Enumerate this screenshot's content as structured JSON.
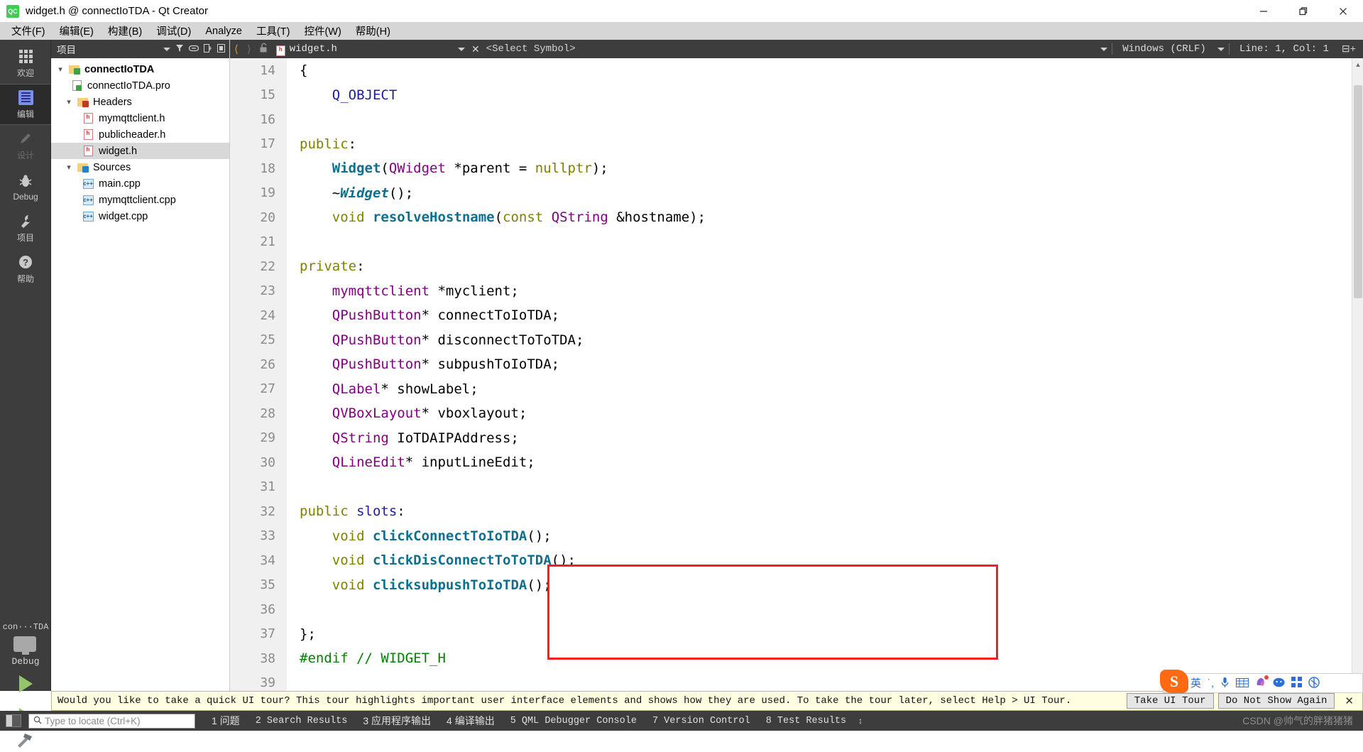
{
  "window": {
    "title": "widget.h @ connectIoTDA - Qt Creator",
    "app_icon": "qt-creator-icon",
    "minimize": "—",
    "restore": "❐",
    "close": "✕"
  },
  "menubar": {
    "items": [
      {
        "label": "文件(F)",
        "name": "menu-file"
      },
      {
        "label": "编辑(E)",
        "name": "menu-edit"
      },
      {
        "label": "构建(B)",
        "name": "menu-build"
      },
      {
        "label": "调试(D)",
        "name": "menu-debug"
      },
      {
        "label": "Analyze",
        "name": "menu-analyze"
      },
      {
        "label": "工具(T)",
        "name": "menu-tools"
      },
      {
        "label": "控件(W)",
        "name": "menu-window"
      },
      {
        "label": "帮助(H)",
        "name": "menu-help"
      }
    ]
  },
  "modebar": {
    "items": [
      {
        "label": "欢迎",
        "icon": "grid-icon",
        "state": "normal"
      },
      {
        "label": "编辑",
        "icon": "document-icon",
        "state": "active"
      },
      {
        "label": "设计",
        "icon": "pencil-icon",
        "state": "disabled"
      },
      {
        "label": "Debug",
        "icon": "bug-icon",
        "state": "normal"
      },
      {
        "label": "项目",
        "icon": "wrench-icon",
        "state": "normal"
      },
      {
        "label": "帮助",
        "icon": "question-icon",
        "state": "normal"
      }
    ],
    "kit": {
      "project": "con···TDA",
      "build_config": "Debug",
      "run_icon": "run-triangle-icon",
      "debug_icon": "run-debug-icon",
      "build_icon": "hammer-icon"
    }
  },
  "sidebar": {
    "header_title": "项目",
    "tools": [
      "filter-icon",
      "link-icon",
      "split-icon",
      "settings-icon"
    ],
    "tree": [
      {
        "label": "connectIoTDA",
        "icon": "qt-project-folder-icon",
        "indent": 0,
        "twisty": "expanded",
        "bold": true,
        "selected": false
      },
      {
        "label": "connectIoTDA.pro",
        "icon": "qt-pro-file-icon",
        "indent": 1,
        "twisty": "none",
        "bold": false,
        "selected": false
      },
      {
        "label": "Headers",
        "icon": "headers-folder-icon",
        "indent": 1,
        "twisty": "expanded",
        "bold": false,
        "selected": false
      },
      {
        "label": "mymqttclient.h",
        "icon": "h-file-icon",
        "indent": 2,
        "twisty": "none",
        "bold": false,
        "selected": false
      },
      {
        "label": "publicheader.h",
        "icon": "h-file-icon",
        "indent": 2,
        "twisty": "none",
        "bold": false,
        "selected": false
      },
      {
        "label": "widget.h",
        "icon": "h-file-icon",
        "indent": 2,
        "twisty": "none",
        "bold": false,
        "selected": true
      },
      {
        "label": "Sources",
        "icon": "sources-folder-icon",
        "indent": 1,
        "twisty": "expanded",
        "bold": false,
        "selected": false
      },
      {
        "label": "main.cpp",
        "icon": "cpp-file-icon",
        "indent": 2,
        "twisty": "none",
        "bold": false,
        "selected": false
      },
      {
        "label": "mymqttclient.cpp",
        "icon": "cpp-file-icon",
        "indent": 2,
        "twisty": "none",
        "bold": false,
        "selected": false
      },
      {
        "label": "widget.cpp",
        "icon": "cpp-file-icon",
        "indent": 2,
        "twisty": "none",
        "bold": false,
        "selected": false
      }
    ]
  },
  "editor_toolbar": {
    "back_icon": "back-arrow-icon",
    "forward_icon": "forward-arrow-icon",
    "lock_icon": "unlock-icon",
    "file_icon": "h-file-icon",
    "file_name": "widget.h",
    "close_icon": "close-icon",
    "symbol_selector": "<Select Symbol>",
    "line_ending": "Windows (CRLF)",
    "cursor_position": "Line: 1, Col: 1",
    "split_icon": "split-editor-icon"
  },
  "code": {
    "first_line": 14,
    "lines": [
      {
        "num": "14",
        "tokens": [
          {
            "t": "{",
            "c": "punct"
          }
        ],
        "indent": 0
      },
      {
        "num": "15",
        "tokens": [
          {
            "t": "    ",
            "c": "plain"
          },
          {
            "t": "Q_OBJECT",
            "c": "macro"
          }
        ],
        "indent": 0
      },
      {
        "num": "16",
        "tokens": [],
        "indent": 0
      },
      {
        "num": "17",
        "tokens": [
          {
            "t": "public",
            "c": "kw"
          },
          {
            "t": ":",
            "c": "punct"
          }
        ],
        "indent": 0
      },
      {
        "num": "18",
        "tokens": [
          {
            "t": "    ",
            "c": "plain"
          },
          {
            "t": "Widget",
            "c": "fn"
          },
          {
            "t": "(",
            "c": "punct"
          },
          {
            "t": "QWidget",
            "c": "type"
          },
          {
            "t": " *parent = ",
            "c": "punct"
          },
          {
            "t": "nullptr",
            "c": "kw"
          },
          {
            "t": ");",
            "c": "punct"
          }
        ],
        "indent": 0
      },
      {
        "num": "19",
        "tokens": [
          {
            "t": "    ~",
            "c": "punct"
          },
          {
            "t": "Widget",
            "c": "fnd"
          },
          {
            "t": "();",
            "c": "punct"
          }
        ],
        "indent": 0
      },
      {
        "num": "20",
        "tokens": [
          {
            "t": "    ",
            "c": "plain"
          },
          {
            "t": "void",
            "c": "kw"
          },
          {
            "t": " ",
            "c": "plain"
          },
          {
            "t": "resolveHostname",
            "c": "fn"
          },
          {
            "t": "(",
            "c": "punct"
          },
          {
            "t": "const",
            "c": "kw"
          },
          {
            "t": " ",
            "c": "plain"
          },
          {
            "t": "QString",
            "c": "type"
          },
          {
            "t": " &hostname);",
            "c": "punct"
          }
        ],
        "indent": 0
      },
      {
        "num": "21",
        "tokens": [],
        "indent": 0
      },
      {
        "num": "22",
        "tokens": [
          {
            "t": "private",
            "c": "kw"
          },
          {
            "t": ":",
            "c": "punct"
          }
        ],
        "indent": 0
      },
      {
        "num": "23",
        "tokens": [
          {
            "t": "    ",
            "c": "plain"
          },
          {
            "t": "mymqttclient",
            "c": "type"
          },
          {
            "t": " *myclient;",
            "c": "punct"
          }
        ],
        "indent": 0
      },
      {
        "num": "24",
        "tokens": [
          {
            "t": "    ",
            "c": "plain"
          },
          {
            "t": "QPushButton",
            "c": "type"
          },
          {
            "t": "* connectToIoTDA;",
            "c": "punct"
          }
        ],
        "indent": 0
      },
      {
        "num": "25",
        "tokens": [
          {
            "t": "    ",
            "c": "plain"
          },
          {
            "t": "QPushButton",
            "c": "type"
          },
          {
            "t": "* disconnectToToTDA;",
            "c": "punct"
          }
        ],
        "indent": 0
      },
      {
        "num": "26",
        "tokens": [
          {
            "t": "    ",
            "c": "plain"
          },
          {
            "t": "QPushButton",
            "c": "type"
          },
          {
            "t": "* subpushToIoTDA;",
            "c": "punct"
          }
        ],
        "indent": 0
      },
      {
        "num": "27",
        "tokens": [
          {
            "t": "    ",
            "c": "plain"
          },
          {
            "t": "QLabel",
            "c": "type"
          },
          {
            "t": "* showLabel;",
            "c": "punct"
          }
        ],
        "indent": 0
      },
      {
        "num": "28",
        "tokens": [
          {
            "t": "    ",
            "c": "plain"
          },
          {
            "t": "QVBoxLayout",
            "c": "type"
          },
          {
            "t": "* vboxlayout;",
            "c": "punct"
          }
        ],
        "indent": 0
      },
      {
        "num": "29",
        "tokens": [
          {
            "t": "    ",
            "c": "plain"
          },
          {
            "t": "QString",
            "c": "type"
          },
          {
            "t": " IoTDAIPAddress;",
            "c": "punct"
          }
        ],
        "indent": 0
      },
      {
        "num": "30",
        "tokens": [
          {
            "t": "    ",
            "c": "plain"
          },
          {
            "t": "QLineEdit",
            "c": "type"
          },
          {
            "t": "* inputLineEdit;",
            "c": "punct"
          }
        ],
        "indent": 0
      },
      {
        "num": "31",
        "tokens": [],
        "indent": 0
      },
      {
        "num": "32",
        "tokens": [
          {
            "t": "public",
            "c": "kw"
          },
          {
            "t": " ",
            "c": "plain"
          },
          {
            "t": "slots",
            "c": "macro"
          },
          {
            "t": ":",
            "c": "punct"
          }
        ],
        "indent": 0
      },
      {
        "num": "33",
        "tokens": [
          {
            "t": "    ",
            "c": "plain"
          },
          {
            "t": "void",
            "c": "kw"
          },
          {
            "t": " ",
            "c": "plain"
          },
          {
            "t": "clickConnectToIoTDA",
            "c": "fn"
          },
          {
            "t": "();",
            "c": "punct"
          }
        ],
        "indent": 0
      },
      {
        "num": "34",
        "tokens": [
          {
            "t": "    ",
            "c": "plain"
          },
          {
            "t": "void",
            "c": "kw"
          },
          {
            "t": " ",
            "c": "plain"
          },
          {
            "t": "clickDisConnectToToTDA",
            "c": "fn"
          },
          {
            "t": "();",
            "c": "punct"
          }
        ],
        "indent": 0
      },
      {
        "num": "35",
        "tokens": [
          {
            "t": "    ",
            "c": "plain"
          },
          {
            "t": "void",
            "c": "kw"
          },
          {
            "t": " ",
            "c": "plain"
          },
          {
            "t": "clicksubpushToIoTDA",
            "c": "fn"
          },
          {
            "t": "();",
            "c": "punct"
          }
        ],
        "indent": 0
      },
      {
        "num": "36",
        "tokens": [],
        "indent": 0
      },
      {
        "num": "37",
        "tokens": [
          {
            "t": "};",
            "c": "punct"
          }
        ],
        "indent": 0
      },
      {
        "num": "38",
        "tokens": [
          {
            "t": "#endif",
            "c": "pre"
          },
          {
            "t": " ",
            "c": "plain"
          },
          {
            "t": "// WIDGET_H",
            "c": "cmt"
          }
        ],
        "indent": 0
      },
      {
        "num": "39",
        "tokens": [],
        "indent": 0
      }
    ],
    "highlight_box_color": "#f02020"
  },
  "tour": {
    "message": "Would you like to take a quick UI tour? This tour highlights important user interface elements and shows how they are used. To take the tour later, select Help > UI Tour.",
    "take_tour_label": "Take UI Tour",
    "dismiss_label": "Do Not Show Again",
    "close_icon": "close-icon",
    "bg_color": "#fffee0"
  },
  "statusbar": {
    "toggle_icon": "toggle-sidebar-icon",
    "locate_placeholder": "Type to locate (Ctrl+K)",
    "search_icon": "search-icon",
    "tabs": [
      {
        "num": "1",
        "label": "问题",
        "cjk": true
      },
      {
        "num": "2",
        "label": "Search Results",
        "cjk": false
      },
      {
        "num": "3",
        "label": "应用程序输出",
        "cjk": true
      },
      {
        "num": "4",
        "label": "编译输出",
        "cjk": true
      },
      {
        "num": "5",
        "label": "QML Debugger Console",
        "cjk": false
      },
      {
        "num": "7",
        "label": "Version Control",
        "cjk": false
      },
      {
        "num": "8",
        "label": "Test Results",
        "cjk": false
      }
    ],
    "updown_icon": "up-down-arrow-icon",
    "watermark": "CSDN @帅气的胖猪猪猪"
  },
  "ime_tray": {
    "logo": "sogou-logo-icon",
    "items": [
      "英",
      "punctuation-icon",
      "microphone-icon",
      "keyboard-icon",
      "skin-icon",
      "smiley-icon",
      "apps-icon",
      "toolbox-icon"
    ]
  }
}
